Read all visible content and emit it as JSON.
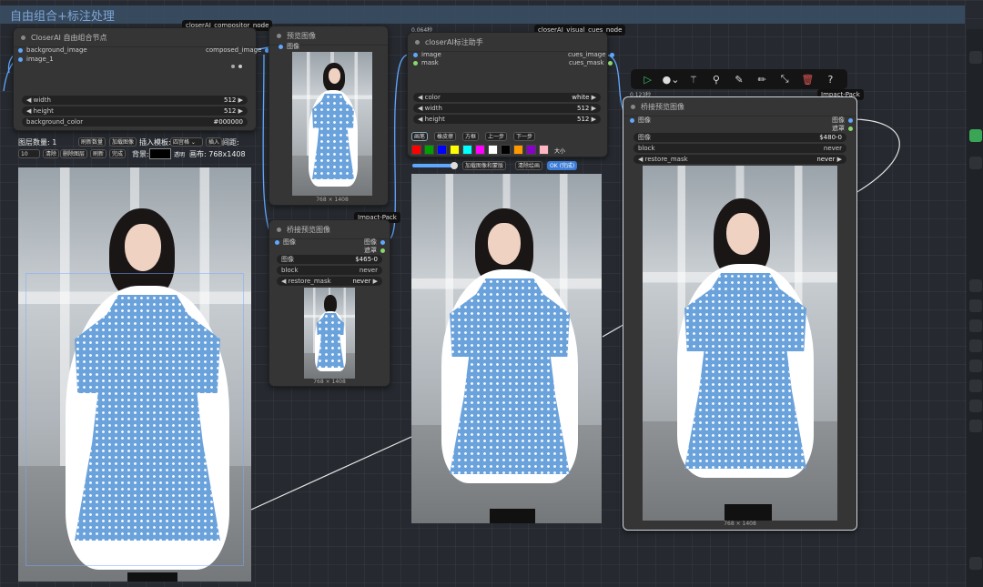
{
  "group": {
    "title": "自由组合+标注处理"
  },
  "compositor": {
    "tag": "closerAI_compositor_node",
    "title": "CloserAI 自由组合节点",
    "inputs": [
      "background_image",
      "image_1"
    ],
    "output": "composed_image",
    "widgets": [
      {
        "label": "width",
        "value": "512"
      },
      {
        "label": "height",
        "value": "512"
      },
      {
        "label": "background_color",
        "value": "#000000"
      }
    ],
    "controls": {
      "layer_count_label": "图层数量: 1",
      "refresh_count": "刷新数量",
      "load_image": "加载图像",
      "insert_template_label": "插入模板:",
      "template_value": "四宫格",
      "insert": "插入",
      "spacing_label": "间距:",
      "spacing_value": "10",
      "clear": "清除",
      "delete_layer": "删除图层",
      "refresh": "刷新",
      "done": "完成",
      "background_label": "背景:",
      "transparent": "透明",
      "canvas_size": "画布: 768x1408"
    }
  },
  "preview1": {
    "title": "预览图像",
    "input": "图像",
    "dims": "768 × 1408"
  },
  "bridge1": {
    "tag": "Impact-Pack",
    "title": "桥接预览图像",
    "input": "图像",
    "outputs": [
      "图像",
      "遮罩"
    ],
    "widgets": [
      {
        "label": "图像",
        "value": "$465-0"
      },
      {
        "label": "block",
        "value": "never"
      },
      {
        "label": "restore_mask",
        "value": "never"
      }
    ],
    "dims": "768 × 1408"
  },
  "cues": {
    "time": "0.064秒",
    "tag": "closerAI_visual_cues_node",
    "title": "closerAI标注助手",
    "inputs": [
      "image",
      "mask"
    ],
    "outputs": [
      "cues_image",
      "cues_mask"
    ],
    "widgets": [
      {
        "label": "color",
        "value": "white"
      },
      {
        "label": "width",
        "value": "512"
      },
      {
        "label": "height",
        "value": "512"
      }
    ],
    "tools": [
      "画笔",
      "橡皮擦",
      "方框",
      "上一步",
      "下一步"
    ],
    "colors": [
      "#ff0000",
      "#00a000",
      "#0000ff",
      "#ffff00",
      "#00ffff",
      "#ff00ff",
      "#ffffff",
      "#000000",
      "#ff9900",
      "#8a00c8",
      "#ffb6c1"
    ],
    "size_label": "大小",
    "actions": [
      "加载图像和蒙版",
      "清除绘画",
      "OK (完成)"
    ]
  },
  "bridge2": {
    "time": "0.123秒",
    "tag": "Impact-Pack",
    "title": "桥接预览图像",
    "input": "图像",
    "outputs": [
      "图像",
      "遮罩"
    ],
    "widgets": [
      {
        "label": "图像",
        "value": "$480-0"
      },
      {
        "label": "block",
        "value": "never"
      },
      {
        "label": "restore_mask",
        "value": "never"
      }
    ],
    "dims": "768 × 1408"
  },
  "toolbar": {
    "icons": [
      "play-icon",
      "color-circle-icon",
      "magic-wand-icon",
      "pin-icon",
      "edit-icon",
      "pencil-icon",
      "collapse-icon",
      "trash-icon",
      "help-icon"
    ]
  }
}
